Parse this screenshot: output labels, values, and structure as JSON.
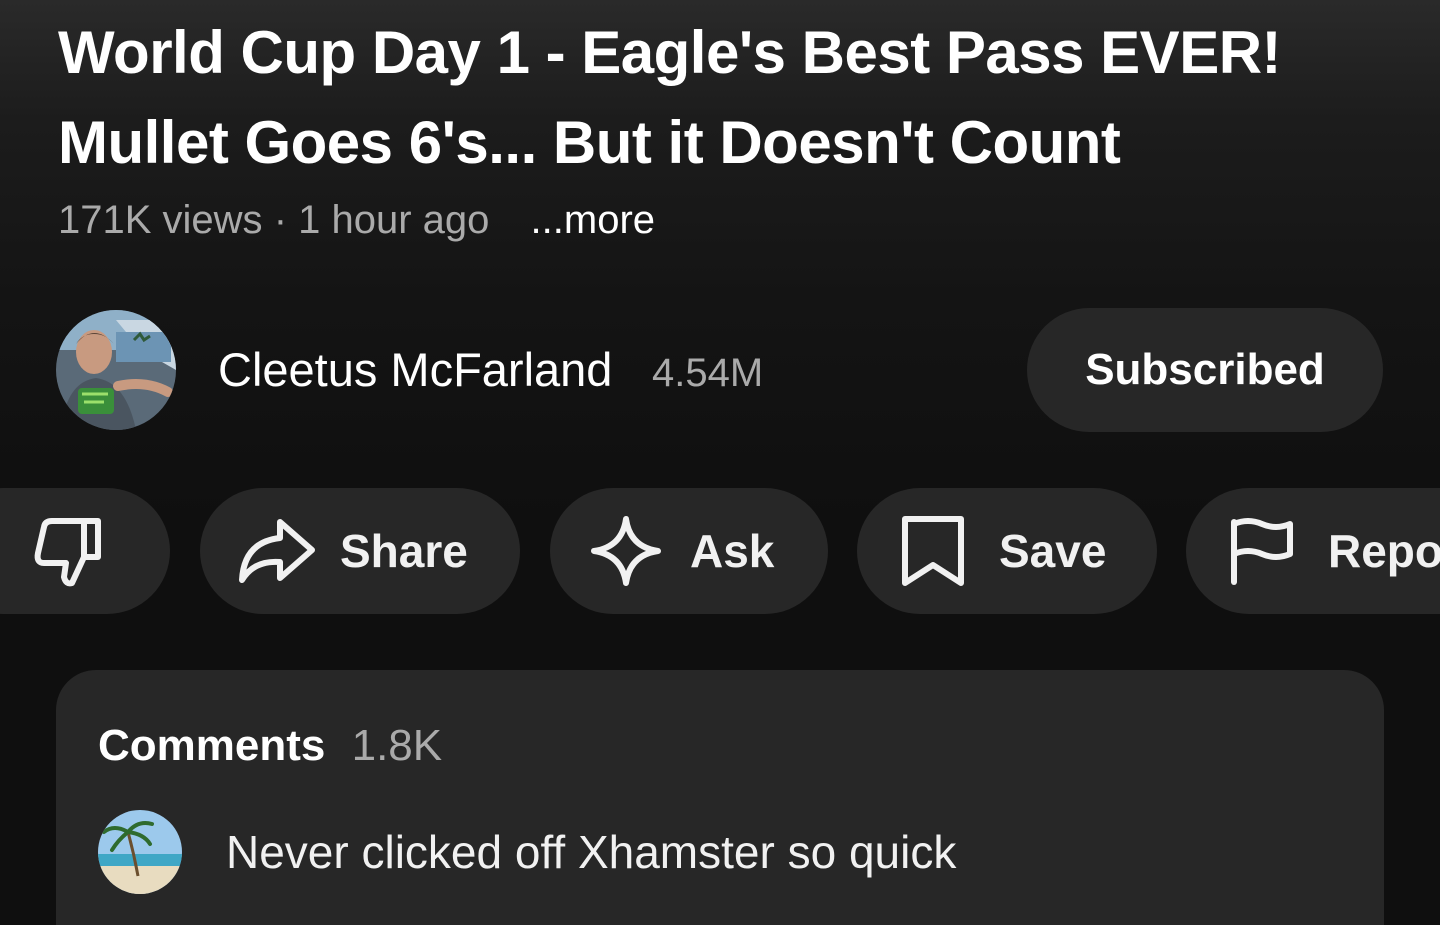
{
  "video": {
    "title": "World Cup Day 1 - Eagle's Best Pass EVER! Mullet Goes 6's... But it Doesn't Count",
    "views": "171K views",
    "separator": "·",
    "age": "1 hour ago",
    "more_label": "...more"
  },
  "channel": {
    "name": "Cleetus McFarland",
    "subscribers": "4.54M",
    "subscribe_label": "Subscribed",
    "avatar_icon": "channel-avatar-photo"
  },
  "actions": {
    "dislike_icon": "thumbs-down-icon",
    "share_label": "Share",
    "share_icon": "share-arrow-icon",
    "ask_label": "Ask",
    "ask_icon": "sparkle-icon",
    "save_label": "Save",
    "save_icon": "bookmark-icon",
    "report_label": "Repo",
    "report_icon": "flag-icon"
  },
  "comments": {
    "title": "Comments",
    "count": "1.8K",
    "top_comment": {
      "text": "Never clicked off Xhamster so quick",
      "avatar_icon": "beach-palm-avatar"
    }
  },
  "colors": {
    "background": "#0f0f0f",
    "pill": "#272727",
    "primary_text": "#f1f1f1",
    "secondary_text": "#aaaaaa"
  }
}
